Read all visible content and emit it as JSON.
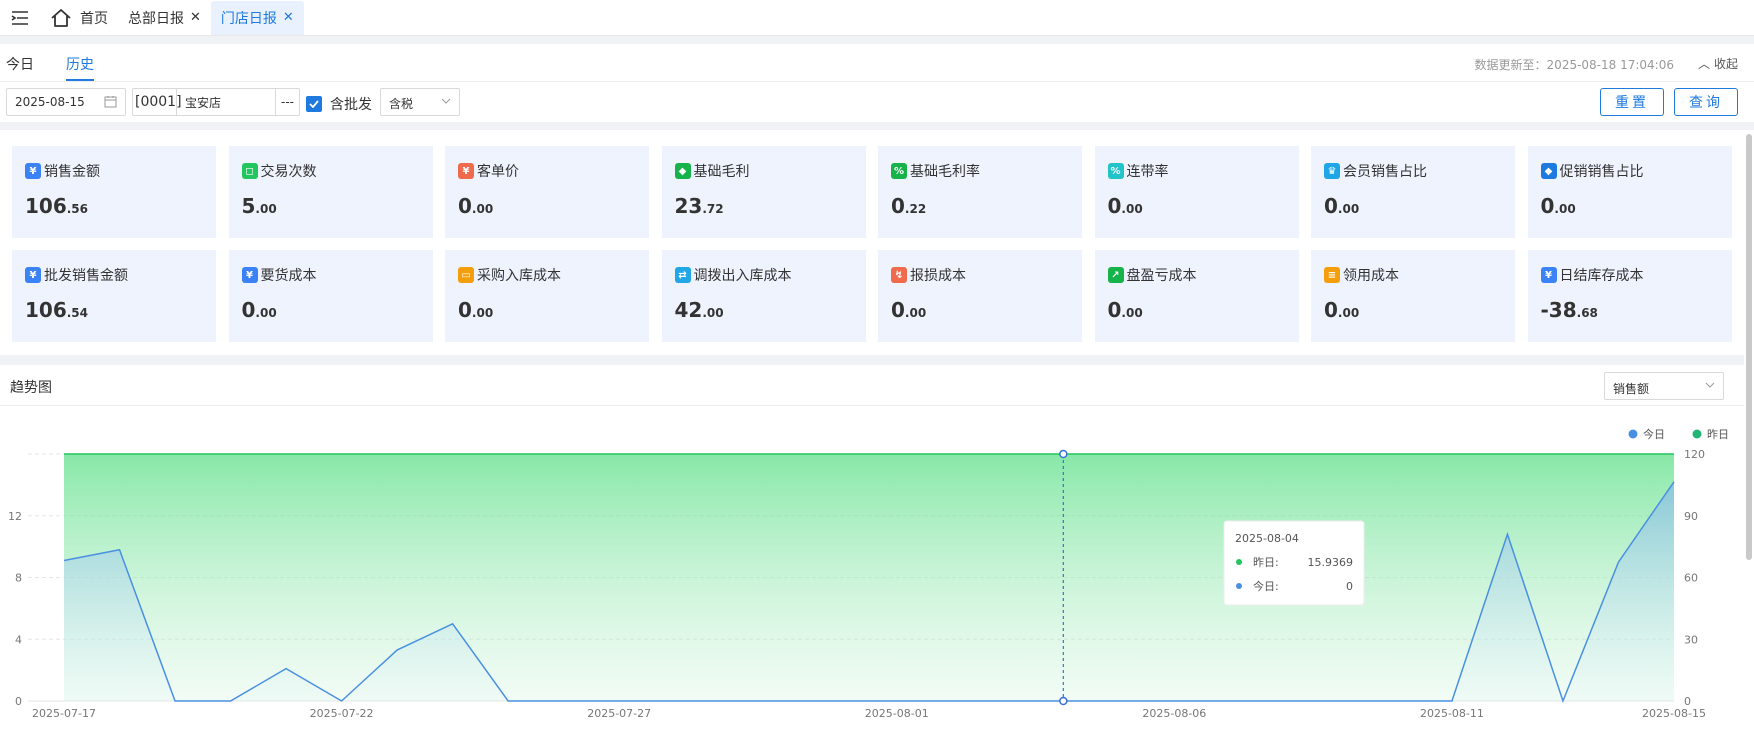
{
  "tabs": [
    {
      "label": "首页"
    },
    {
      "label": "总部日报"
    },
    {
      "label": "门店日报"
    }
  ],
  "subtabs": [
    {
      "label": "今日"
    },
    {
      "label": "历史"
    }
  ],
  "update_info": "数据更新至：2025-08-18 17:04:06",
  "collapse_label": "收起",
  "filters": {
    "date": "2025-08-15",
    "store_code": "[0001]",
    "store_name": "宝安店",
    "store_more": "---",
    "wholesale_label": "含批发",
    "wholesale_checked": true,
    "tax_option": "含税",
    "reset_label": "重置",
    "query_label": "查询"
  },
  "metrics": [
    {
      "label": "销售金额",
      "int": "106",
      "dec": ".56",
      "icon": "yen-bag-icon",
      "color": "#3b82f6"
    },
    {
      "label": "交易次数",
      "int": "5",
      "dec": ".00",
      "icon": "bag-icon",
      "color": "#22c55e"
    },
    {
      "label": "客单价",
      "int": "0",
      "dec": ".00",
      "icon": "yen-icon",
      "color": "#f06a4e"
    },
    {
      "label": "基础毛利",
      "int": "23",
      "dec": ".72",
      "icon": "diamond-icon",
      "color": "#16b34a"
    },
    {
      "label": "基础毛利率",
      "int": "0",
      "dec": ".22",
      "icon": "percent-badge-icon",
      "color": "#16b34a"
    },
    {
      "label": "连带率",
      "int": "0",
      "dec": ".00",
      "icon": "link-percent-icon",
      "color": "#22c3c9"
    },
    {
      "label": "会员销售占比",
      "int": "0",
      "dec": ".00",
      "icon": "crown-icon",
      "color": "#1fa6e6"
    },
    {
      "label": "促销销售占比",
      "int": "0",
      "dec": ".00",
      "icon": "tag-icon",
      "color": "#1f7ae0"
    },
    {
      "label": "批发销售金额",
      "int": "106",
      "dec": ".54",
      "icon": "yen-stack-icon",
      "color": "#3b82f6"
    },
    {
      "label": "要货成本",
      "int": "0",
      "dec": ".00",
      "icon": "yen-circle-icon",
      "color": "#3b82f6"
    },
    {
      "label": "采购入库成本",
      "int": "0",
      "dec": ".00",
      "icon": "cart-icon",
      "color": "#f59e0b"
    },
    {
      "label": "调拨出入库成本",
      "int": "42",
      "dec": ".00",
      "icon": "transfer-icon",
      "color": "#22a7e6"
    },
    {
      "label": "报损成本",
      "int": "0",
      "dec": ".00",
      "icon": "loss-icon",
      "color": "#f06a4e"
    },
    {
      "label": "盘盈亏成本",
      "int": "0",
      "dec": ".00",
      "icon": "trend-icon",
      "color": "#16b34a"
    },
    {
      "label": "领用成本",
      "int": "0",
      "dec": ".00",
      "icon": "clipboard-icon",
      "color": "#f59e0b"
    },
    {
      "label": "日结库存成本",
      "int": "-38",
      "dec": ".68",
      "icon": "yen-circle-icon",
      "color": "#3b82f6"
    }
  ],
  "trend": {
    "title": "趋势图",
    "metric_select": "销售额"
  },
  "chart_data": {
    "type": "area",
    "x": [
      "2025-07-17",
      "2025-07-18",
      "2025-07-19",
      "2025-07-20",
      "2025-07-21",
      "2025-07-22",
      "2025-07-23",
      "2025-07-24",
      "2025-07-25",
      "2025-07-26",
      "2025-07-27",
      "2025-07-28",
      "2025-07-29",
      "2025-07-30",
      "2025-07-31",
      "2025-08-01",
      "2025-08-02",
      "2025-08-03",
      "2025-08-04",
      "2025-08-05",
      "2025-08-06",
      "2025-08-07",
      "2025-08-08",
      "2025-08-09",
      "2025-08-10",
      "2025-08-11",
      "2025-08-12",
      "2025-08-13",
      "2025-08-14",
      "2025-08-15"
    ],
    "x_ticks": [
      "2025-07-17",
      "2025-07-22",
      "2025-07-27",
      "2025-08-01",
      "2025-08-06",
      "2025-08-11",
      "2025-08-15"
    ],
    "series": [
      {
        "name": "今日",
        "axis": "left",
        "color": "#4a90e2",
        "values": [
          9.1,
          9.8,
          0,
          0,
          2.1,
          0,
          3.3,
          5.0,
          0,
          0,
          0,
          0,
          0,
          0,
          0,
          0,
          0,
          0,
          0,
          0,
          0,
          0,
          0,
          0,
          0,
          0,
          10.8,
          0,
          9.0,
          14.2
        ]
      },
      {
        "name": "昨日",
        "axis": "right",
        "color": "#22c55e",
        "values": [
          120,
          120,
          120,
          120,
          120,
          120,
          120,
          120,
          120,
          120,
          120,
          120,
          120,
          120,
          120,
          120,
          120,
          120,
          120,
          120,
          120,
          120,
          120,
          120,
          120,
          120,
          120,
          120,
          120,
          120
        ]
      }
    ],
    "y_left_ticks": [
      0,
      4,
      8,
      12
    ],
    "y_left_max": 16,
    "y_right_ticks": [
      0,
      30,
      60,
      90,
      120
    ],
    "y_right_max": 120,
    "legend": "top-right",
    "tooltip": {
      "date": "2025-08-04",
      "rows": [
        {
          "label": "昨日:",
          "value": "15.9369",
          "color": "#22c55e"
        },
        {
          "label": "今日:",
          "value": "0",
          "color": "#4a90e2"
        }
      ]
    }
  }
}
